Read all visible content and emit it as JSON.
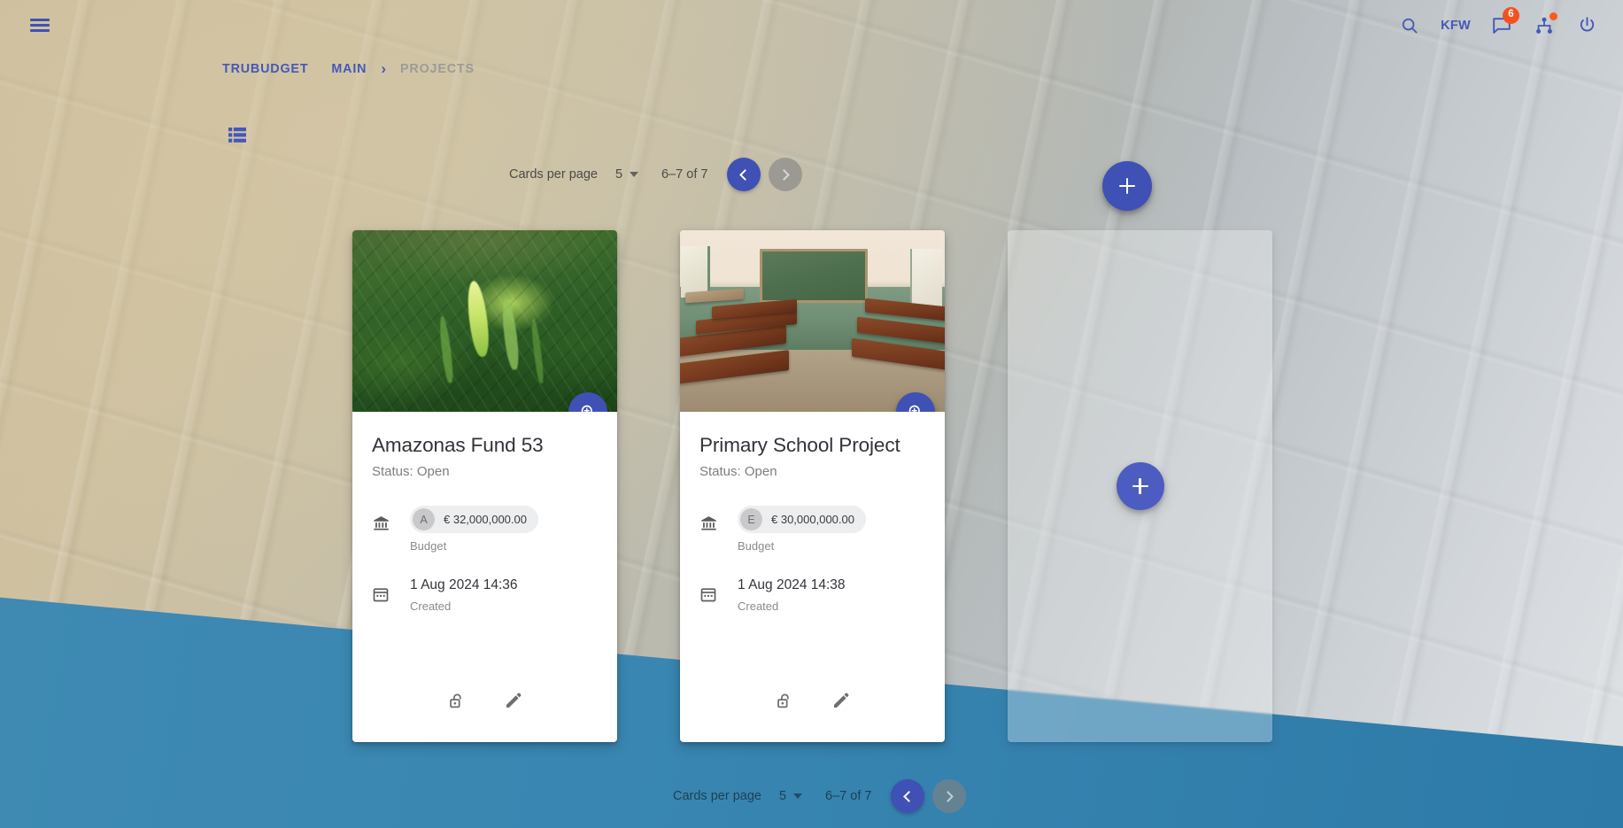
{
  "top_bar": {
    "menu_icon": "hamburger-menu-icon",
    "search_icon": "search-icon",
    "org_label": "KFW",
    "notifications_icon": "chat-bubble-icon",
    "notifications_count": "6",
    "network_icon": "sitemap-icon",
    "logout_icon": "power-icon"
  },
  "breadcrumb": {
    "items": [
      {
        "label": "TRUBUDGET",
        "current": false
      },
      {
        "label": "MAIN",
        "current": false
      },
      {
        "label": "PROJECTS",
        "current": true
      }
    ],
    "separator": "›"
  },
  "toolbar": {
    "view_toggle_icon": "list-view-icon"
  },
  "pagination": {
    "cards_per_page_label": "Cards per page",
    "cards_per_page_value": "5",
    "range_label": "6–7 of 7",
    "prev_icon": "chevron-left-icon",
    "next_icon": "chevron-right-icon",
    "prev_enabled": true,
    "next_enabled": false
  },
  "fab": {
    "add_project_icon": "plus-icon",
    "add_project_card_icon": "plus-icon"
  },
  "cards": [
    {
      "title": "Amazonas Fund 53",
      "status": "Status: Open",
      "media": "rainforest-photo",
      "zoom_icon": "zoom-in-icon",
      "budget": {
        "icon": "bank-icon",
        "avatar": "A",
        "amount": "€ 32,000,000.00",
        "caption": "Budget"
      },
      "created": {
        "icon": "calendar-icon",
        "value": "1 Aug 2024 14:36",
        "caption": "Created"
      },
      "actions": [
        {
          "name": "permissions-button",
          "icon": "open-lock-icon"
        },
        {
          "name": "edit-button",
          "icon": "pencil-icon"
        }
      ]
    },
    {
      "title": "Primary School Project",
      "status": "Status: Open",
      "media": "classroom-photo",
      "zoom_icon": "zoom-in-icon",
      "budget": {
        "icon": "bank-icon",
        "avatar": "E",
        "amount": "€ 30,000,000.00",
        "caption": "Budget"
      },
      "created": {
        "icon": "calendar-icon",
        "value": "1 Aug 2024 14:38",
        "caption": "Created"
      },
      "actions": [
        {
          "name": "permissions-button",
          "icon": "open-lock-icon"
        },
        {
          "name": "edit-button",
          "icon": "pencil-icon"
        }
      ]
    }
  ],
  "colors": {
    "primary": "#3f51b5",
    "badge": "#f4511e",
    "status_dot": "#ff5722",
    "blue_wedge": "#3986b2",
    "breadcrumb_link": "#4558b8",
    "breadcrumb_current": "#9b9b98"
  }
}
